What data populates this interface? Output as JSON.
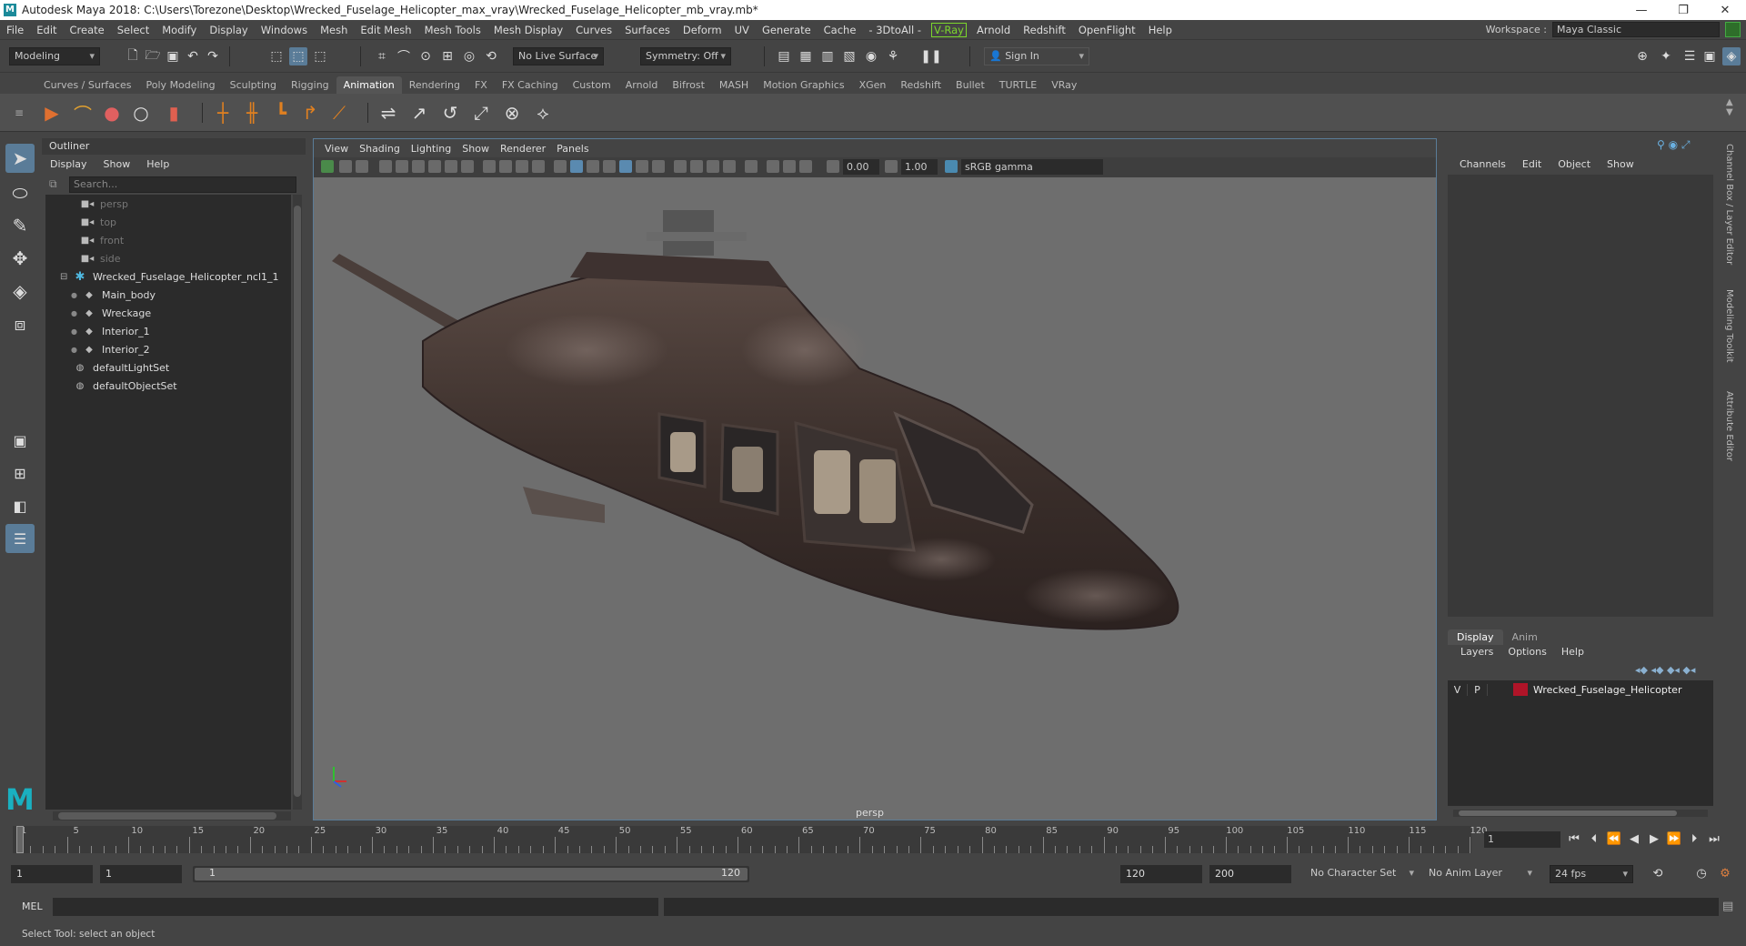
{
  "titlebar": {
    "title": "Autodesk Maya 2018: C:\\Users\\Torezone\\Desktop\\Wrecked_Fuselage_Helicopter_max_vray\\Wrecked_Fuselage_Helicopter_mb_vray.mb*",
    "minimize": "—",
    "restore": "❐",
    "close": "✕"
  },
  "menubar": {
    "items": [
      "File",
      "Edit",
      "Create",
      "Select",
      "Modify",
      "Display",
      "Windows",
      "Mesh",
      "Edit Mesh",
      "Mesh Tools",
      "Mesh Display",
      "Curves",
      "Surfaces",
      "Deform",
      "UV",
      "Generate",
      "Cache",
      "- 3DtoAll -"
    ],
    "vray": "V-Ray",
    "items2": [
      "Arnold",
      "Redshift",
      "OpenFlight",
      "Help"
    ],
    "workspace_label": "Workspace :",
    "workspace_value": "Maya Classic"
  },
  "statusline": {
    "mode": "Modeling",
    "live_surface": "No Live Surface",
    "symmetry": "Symmetry: Off",
    "sign_in": "Sign In"
  },
  "shelf_tabs": [
    "Curves / Surfaces",
    "Poly Modeling",
    "Sculpting",
    "Rigging",
    "Animation",
    "Rendering",
    "FX",
    "FX Caching",
    "Custom",
    "Arnold",
    "Bifrost",
    "MASH",
    "Motion Graphics",
    "XGen",
    "Redshift",
    "Bullet",
    "TURTLE",
    "VRay"
  ],
  "active_shelf_tab": "Animation",
  "outliner": {
    "title": "Outliner",
    "menu": [
      "Display",
      "Show",
      "Help"
    ],
    "search_placeholder": "Search...",
    "rows": [
      "persp",
      "top",
      "front",
      "side",
      "Wrecked_Fuselage_Helicopter_ncl1_1",
      "Main_body",
      "Wreckage",
      "Interior_1",
      "Interior_2",
      "defaultLightSet",
      "defaultObjectSet"
    ]
  },
  "viewport": {
    "menu": [
      "View",
      "Shading",
      "Lighting",
      "Show",
      "Renderer",
      "Panels"
    ],
    "exposure": "0.00",
    "gamma": "1.00",
    "colorspace": "sRGB gamma",
    "camera_label": "persp"
  },
  "channel_box": {
    "menu": [
      "Channels",
      "Edit",
      "Object",
      "Show"
    ],
    "layer_tabs": [
      "Display",
      "Anim"
    ],
    "layer_menu": [
      "Layers",
      "Options",
      "Help"
    ],
    "layer": {
      "v": "V",
      "p": "P",
      "color": "#b01428",
      "name": "Wrecked_Fuselage_Helicopter"
    }
  },
  "side_tabs": [
    "Channel Box / Layer Editor",
    "Modeling Toolkit",
    "Attribute Editor"
  ],
  "timeline": {
    "ticks": [
      "1",
      "5",
      "10",
      "15",
      "20",
      "25",
      "30",
      "35",
      "40",
      "45",
      "50",
      "55",
      "60",
      "65",
      "70",
      "75",
      "80",
      "85",
      "90",
      "95",
      "100",
      "105",
      "110",
      "115",
      "120"
    ],
    "current_frame": "1"
  },
  "range": {
    "start": "1",
    "playback_start": "1",
    "slider_start": "1",
    "slider_end": "120",
    "playback_end": "120",
    "end": "200",
    "character_set": "No Character Set",
    "anim_layer": "No Anim Layer",
    "fps": "24 fps"
  },
  "cmdline": {
    "label": "MEL"
  },
  "helpline": {
    "text": "Select Tool: select an object"
  }
}
